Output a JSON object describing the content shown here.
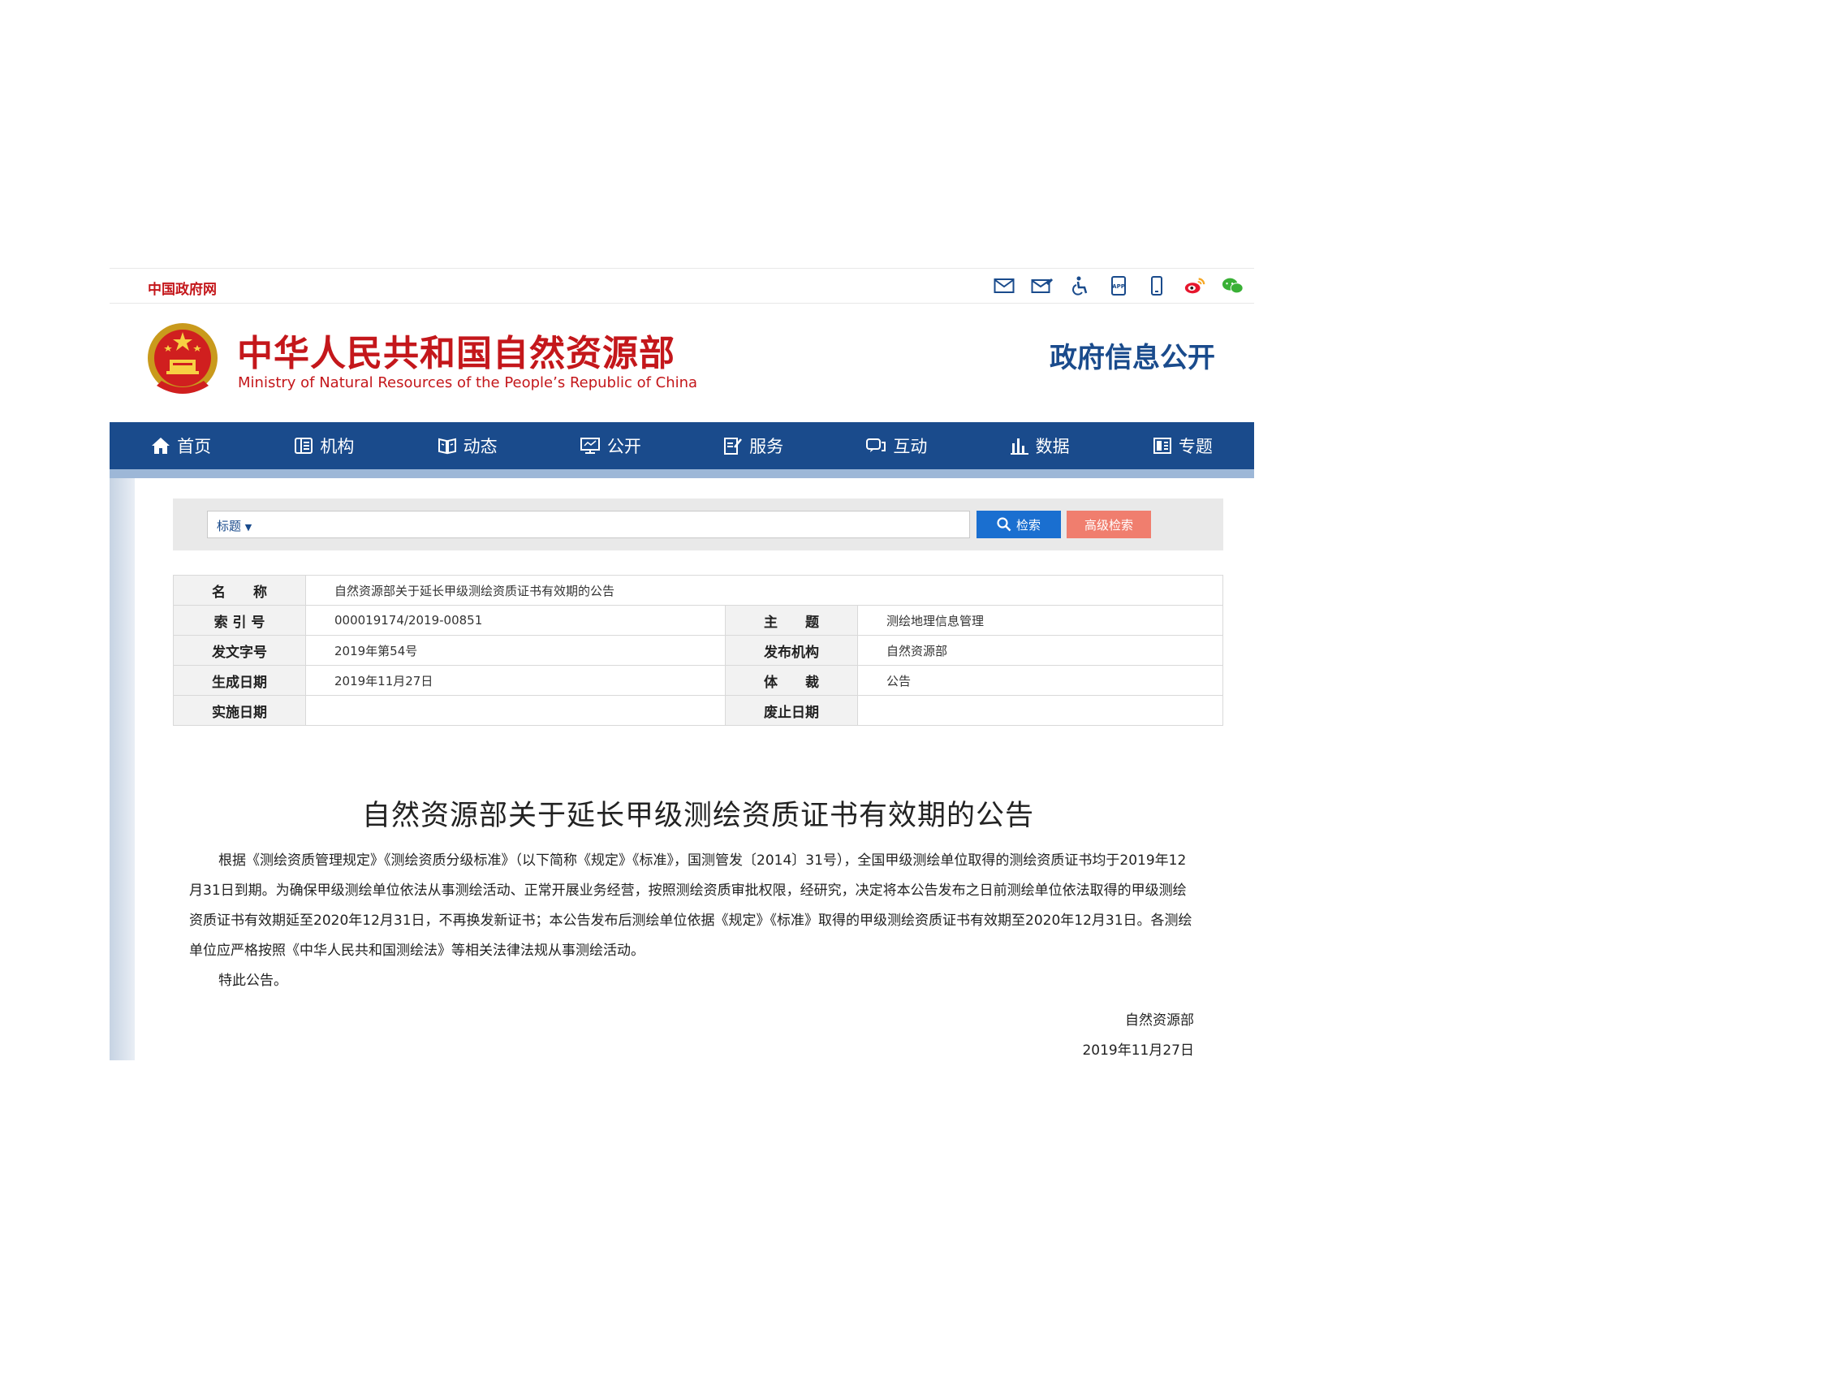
{
  "topbar": {
    "gov_link": "中国政府网",
    "icons": [
      "mail-icon",
      "mail-edit-icon",
      "accessibility-icon",
      "app-icon",
      "mobile-icon",
      "weibo-icon",
      "wechat-icon"
    ],
    "app_icon_text": "APP"
  },
  "header": {
    "title_cn": "中华人民共和国自然资源部",
    "title_en": "Ministry of Natural Resources of the People’s Republic of China",
    "info_open": "政府信息公开"
  },
  "nav": {
    "items": [
      {
        "label": "首页",
        "icon": "home-icon"
      },
      {
        "label": "机构",
        "icon": "org-icon"
      },
      {
        "label": "动态",
        "icon": "news-icon"
      },
      {
        "label": "公开",
        "icon": "screen-icon"
      },
      {
        "label": "服务",
        "icon": "edit-doc-icon"
      },
      {
        "label": "互动",
        "icon": "chat-icon"
      },
      {
        "label": "数据",
        "icon": "chart-icon"
      },
      {
        "label": "专题",
        "icon": "topic-icon"
      }
    ]
  },
  "search": {
    "scope": "标题",
    "placeholder": "",
    "search_label": "检索",
    "advanced_label": "高级检索"
  },
  "meta": {
    "name_label": "名　　称",
    "name_value": "自然资源部关于延长甲级测绘资质证书有效期的公告",
    "index_label": "索 引 号",
    "index_value": "000019174/2019-00851",
    "subject_label": "主　　题",
    "subject_value": "测绘地理信息管理",
    "docno_label": "发文字号",
    "docno_value": "2019年第54号",
    "publisher_label": "发布机构",
    "publisher_value": "自然资源部",
    "gen_date_label": "生成日期",
    "gen_date_value": "2019年11月27日",
    "genre_label": "体　　裁",
    "genre_value": "公告",
    "impl_date_label": "实施日期",
    "impl_date_value": "",
    "abolish_label": "废止日期",
    "abolish_value": ""
  },
  "article": {
    "title": "自然资源部关于延长甲级测绘资质证书有效期的公告",
    "para1": "根据《测绘资质管理规定》《测绘资质分级标准》（以下简称《规定》《标准》，国测管发〔2014〕31号），全国甲级测绘单位取得的测绘资质证书均于2019年12月31日到期。为确保甲级测绘单位依法从事测绘活动、正常开展业务经营，按照测绘资质审批权限，经研究，决定将本公告发布之日前测绘单位依法取得的甲级测绘资质证书有效期延至2020年12月31日，不再换发新证书；本公告发布后测绘单位依据《规定》《标准》取得的甲级测绘资质证书有效期至2020年12月31日。各测绘单位应严格按照《中华人民共和国测绘法》等相关法律法规从事测绘活动。",
    "para2": "特此公告。",
    "sign_org": "自然资源部",
    "sign_date": "2019年11月27日"
  },
  "colors": {
    "brand_red": "#c4171b",
    "nav_blue": "#1a4b8c",
    "search_blue": "#1a6fd0",
    "advanced_salmon": "#f07e6e"
  }
}
